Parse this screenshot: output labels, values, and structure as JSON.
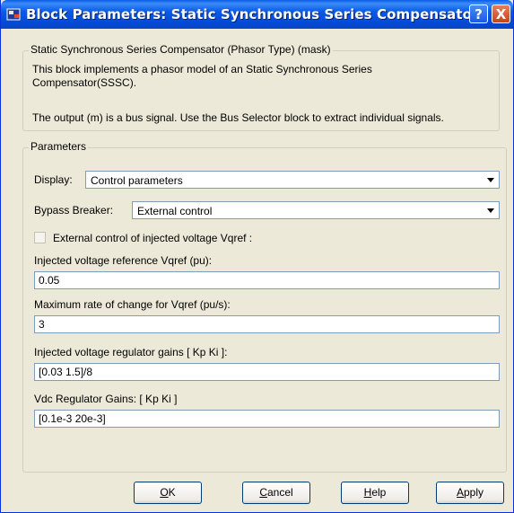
{
  "window": {
    "title": "Block Parameters: Static Synchronous Series Compensato...",
    "help_glyph": "?",
    "close_glyph": "X",
    "app_icon": "simulink-block-icon"
  },
  "mask": {
    "legend": "Static Synchronous Series Compensator (Phasor Type) (mask)",
    "description_line1": "This block implements a phasor model of an Static Synchronous Series",
    "description_line2": "Compensator(SSSC).",
    "description_line3": "The output (m) is a bus signal. Use the Bus Selector block to extract individual signals."
  },
  "parameters": {
    "legend": "Parameters",
    "display_label": "Display:",
    "display_value": "Control parameters",
    "bypass_label": "Bypass Breaker:",
    "bypass_value": "External control",
    "ext_control_label": "External control of injected voltage Vqref :",
    "ext_control_checked": false,
    "vqref_label": "Injected voltage reference Vqref  (pu):",
    "vqref_value": "0.05",
    "rate_label": "Maximum rate of change for Vqref (pu/s):",
    "rate_value": "3",
    "regulator_label": "Injected voltage regulator gains [ Kp  Ki ]:",
    "regulator_value": "[0.03 1.5]/8",
    "vdc_label": "Vdc Regulator Gains: [ Kp  Ki ]",
    "vdc_value": "[0.1e-3 20e-3]"
  },
  "buttons": {
    "ok": {
      "first": "O",
      "rest": "K"
    },
    "cancel": {
      "first": "C",
      "rest": "ancel"
    },
    "help": {
      "first": "H",
      "rest": "elp"
    },
    "apply": {
      "first": "A",
      "rest": "pply"
    }
  },
  "colors": {
    "titlebar": "#0a5ae8",
    "dialog_background": "#ece9d8",
    "close_button": "#c8431a"
  }
}
